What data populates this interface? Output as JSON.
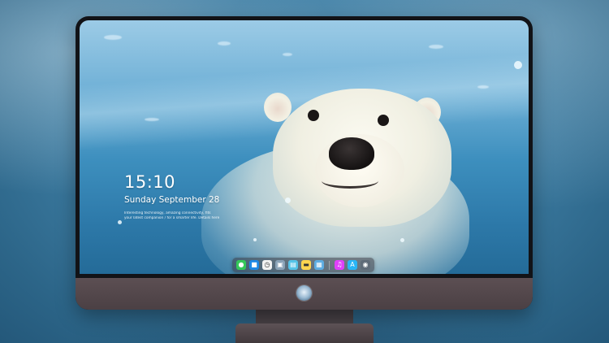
{
  "lock_screen": {
    "time": "15:10",
    "date": "Sunday September 28",
    "notifications": [
      "Interesting technology, amazing connectivity, fits",
      "your latest companion / for a smarter life. Details here"
    ]
  },
  "dock": {
    "apps": [
      {
        "name": "messages-app",
        "icon": "chat-bubble-icon",
        "color": "#34c759",
        "glyph": "●"
      },
      {
        "name": "finder-app",
        "icon": "folder-icon",
        "color": "#1e88e5",
        "glyph": "■"
      },
      {
        "name": "clock-app",
        "icon": "clock-icon",
        "color": "#f2f2f2",
        "glyph": "◷"
      },
      {
        "name": "preview-app",
        "icon": "photo-icon",
        "color": "#8aa3b8",
        "glyph": "▣"
      },
      {
        "name": "claquette-app",
        "icon": "film-icon",
        "color": "#55c3e8",
        "glyph": "▤"
      },
      {
        "name": "notes-app",
        "icon": "note-icon",
        "color": "#ffd54f",
        "glyph": "▬"
      },
      {
        "name": "photos-app",
        "icon": "image-icon",
        "color": "#5dade2",
        "glyph": "▦"
      }
    ],
    "pinned": [
      {
        "name": "music-app",
        "icon": "music-note-icon",
        "color": "#e040fb",
        "glyph": "♫"
      },
      {
        "name": "app-store-app",
        "icon": "app-store-icon",
        "color": "#29b6f6",
        "glyph": "A"
      },
      {
        "name": "screenshot-app",
        "icon": "camera-icon",
        "color": "#5f6b78",
        "glyph": "◉"
      }
    ]
  }
}
